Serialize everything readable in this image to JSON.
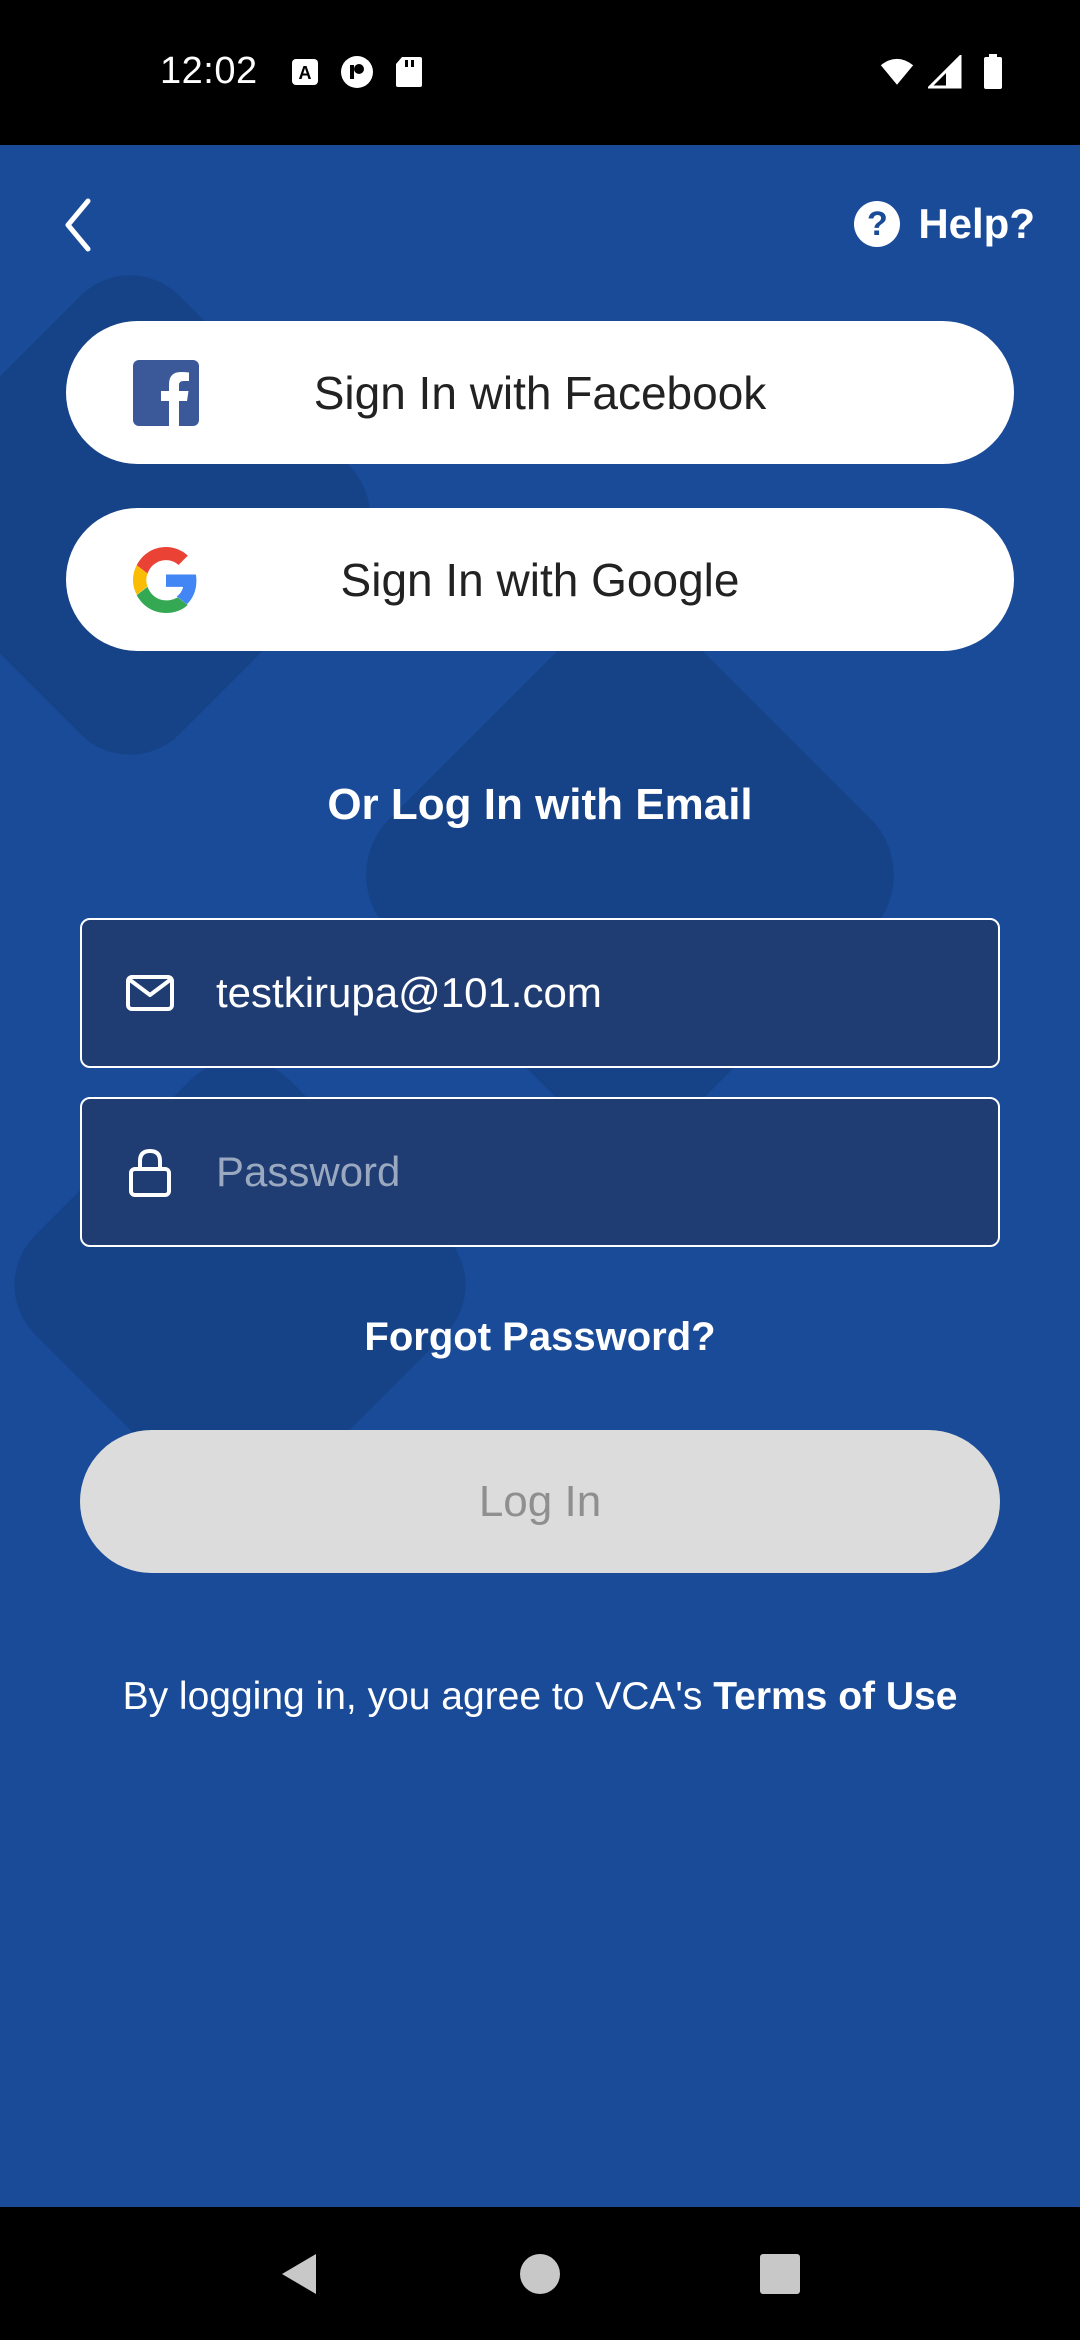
{
  "status_bar": {
    "time": "12:02",
    "icons_left": [
      "text-a-icon",
      "camera-app-icon",
      "sd-card-icon"
    ],
    "icons_right": [
      "wifi-icon",
      "signal-icon",
      "battery-icon"
    ]
  },
  "header": {
    "back_icon": "chevron-left-icon",
    "help_label": "Help?",
    "help_icon": "question-circle-icon"
  },
  "social": {
    "facebook_label": "Sign In with Facebook",
    "google_label": "Sign In with Google"
  },
  "email_section": {
    "heading": "Or Log In with Email",
    "email_value": "testkirupa@101.com",
    "password_placeholder": "Password"
  },
  "forgot_password": "Forgot Password?",
  "login_button": "Log In",
  "terms": {
    "prefix": "By logging in, you agree to VCA's ",
    "link": "Terms of Use"
  },
  "colors": {
    "background": "#1a4b99",
    "field_bg": "#1f3c73",
    "login_disabled": "#dcdcdc",
    "facebook_blue": "#3b5998"
  }
}
